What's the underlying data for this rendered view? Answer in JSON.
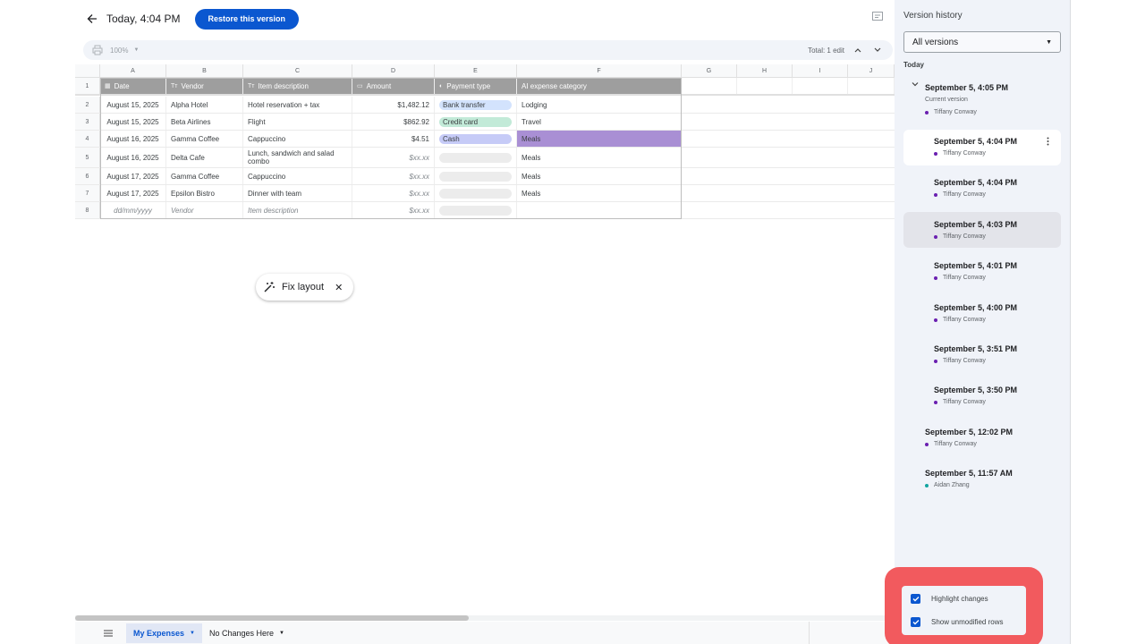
{
  "header": {
    "version_title": "Today, 4:04 PM",
    "restore_label": "Restore this version"
  },
  "toolbar": {
    "zoom": "100%",
    "total_edits": "Total: 1 edit"
  },
  "columns": [
    "A",
    "B",
    "C",
    "D",
    "E",
    "F",
    "G",
    "H",
    "I",
    "J"
  ],
  "table": {
    "headers": [
      "Date",
      "Vendor",
      "Item description",
      "Amount",
      "Payment type",
      "AI expense category"
    ],
    "rows": [
      {
        "num": "1"
      },
      {
        "num": "2",
        "date": "August 15, 2025",
        "vendor": "Alpha Hotel",
        "item": "Hotel reservation + tax",
        "amount": "$1,482.12",
        "payment": "Bank transfer",
        "category": "Lodging"
      },
      {
        "num": "3",
        "date": "August 15, 2025",
        "vendor": "Beta Airlines",
        "item": "Flight",
        "amount": "$862.92",
        "payment": "Credit card",
        "category": "Travel"
      },
      {
        "num": "4",
        "date": "August 16, 2025",
        "vendor": "Gamma Coffee",
        "item": "Cappuccino",
        "amount": "$4.51",
        "payment": "Cash",
        "category": "Meals"
      },
      {
        "num": "5",
        "date": "August 16, 2025",
        "vendor": "Delta Cafe",
        "item": "Lunch, sandwich and salad combo",
        "amount": "$xx.xx",
        "payment": "",
        "category": "Meals"
      },
      {
        "num": "6",
        "date": "August 17, 2025",
        "vendor": "Gamma Coffee",
        "item": "Cappuccino",
        "amount": "$xx.xx",
        "payment": "",
        "category": "Meals"
      },
      {
        "num": "7",
        "date": "August 17, 2025",
        "vendor": "Epsilon Bistro",
        "item": "Dinner with team",
        "amount": "$xx.xx",
        "payment": "",
        "category": "Meals"
      },
      {
        "num": "8",
        "date": "dd/mm/yyyy",
        "vendor": "Vendor",
        "item": "Item description",
        "amount": "$xx.xx",
        "payment": "",
        "category": ""
      }
    ]
  },
  "fix_layout": {
    "label": "Fix layout"
  },
  "bottom_tabs": {
    "tabs": [
      "My Expenses",
      "No Changes Here"
    ]
  },
  "panel": {
    "title": "Version history",
    "filter": "All versions",
    "section": "Today",
    "versions": [
      {
        "time": "September 5, 4:05 PM",
        "note": "Current version",
        "user": "Tiffany Conway"
      },
      {
        "time": "September 5, 4:04 PM",
        "user": "Tiffany Conway"
      },
      {
        "time": "September 5, 4:04 PM",
        "user": "Tiffany Conway"
      },
      {
        "time": "September 5, 4:03 PM",
        "user": "Tiffany Conway"
      },
      {
        "time": "September 5, 4:01 PM",
        "user": "Tiffany Conway"
      },
      {
        "time": "September 5, 4:00 PM",
        "user": "Tiffany Conway"
      },
      {
        "time": "September 5, 3:51 PM",
        "user": "Tiffany Conway"
      },
      {
        "time": "September 5, 3:50 PM",
        "user": "Tiffany Conway"
      },
      {
        "time": "September 5, 12:02 PM",
        "user": "Tiffany Conway"
      },
      {
        "time": "September 5, 11:57 AM",
        "user": "Aidan Zhang"
      }
    ],
    "options": {
      "highlight_changes": "Highlight changes",
      "show_unmodified": "Show unmodified rows"
    }
  },
  "colors": {
    "accent": "#0b57d0",
    "header_grey": "#9e9e9e",
    "highlight_purple": "#a98fd4",
    "callout_red": "#f25a5e",
    "user_dot_purple": "#6a1fb0",
    "user_dot_teal": "#12a4a0"
  },
  "icons": {
    "back": "arrow-left-icon",
    "comment": "comment-icon",
    "print": "print-icon",
    "wand": "magic-wand-icon",
    "menu": "hamburger-icon"
  }
}
